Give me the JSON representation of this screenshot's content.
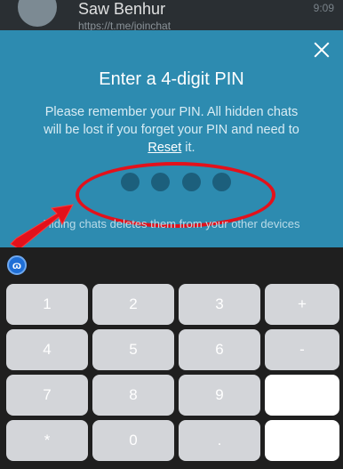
{
  "background_chat": {
    "name": "Saw Benhur",
    "preview": "https://t.me/joinchat",
    "time": "9:09"
  },
  "pin_dialog": {
    "title": "Enter a 4-digit PIN",
    "message_part1": "Please remember your PIN. All hidden chats will be lost if you forget your PIN and need to ",
    "reset_link": "Reset",
    "message_part2": " it.",
    "hint": "Hiding chats deletes them from your other devices",
    "digits_entered": 0,
    "digits_total": 4
  },
  "keyboard": {
    "switcher_label": "ɷ",
    "keys": [
      {
        "label": "1"
      },
      {
        "label": "2"
      },
      {
        "label": "3"
      },
      {
        "label": "+"
      },
      {
        "label": "4"
      },
      {
        "label": "5"
      },
      {
        "label": "6"
      },
      {
        "label": "-"
      },
      {
        "label": "7"
      },
      {
        "label": "8"
      },
      {
        "label": "9"
      },
      {
        "label": ""
      },
      {
        "label": "*"
      },
      {
        "label": "0"
      },
      {
        "label": "."
      },
      {
        "label": ""
      }
    ]
  },
  "colors": {
    "panel": "#2d8bb0",
    "annotation": "#e3111b"
  }
}
